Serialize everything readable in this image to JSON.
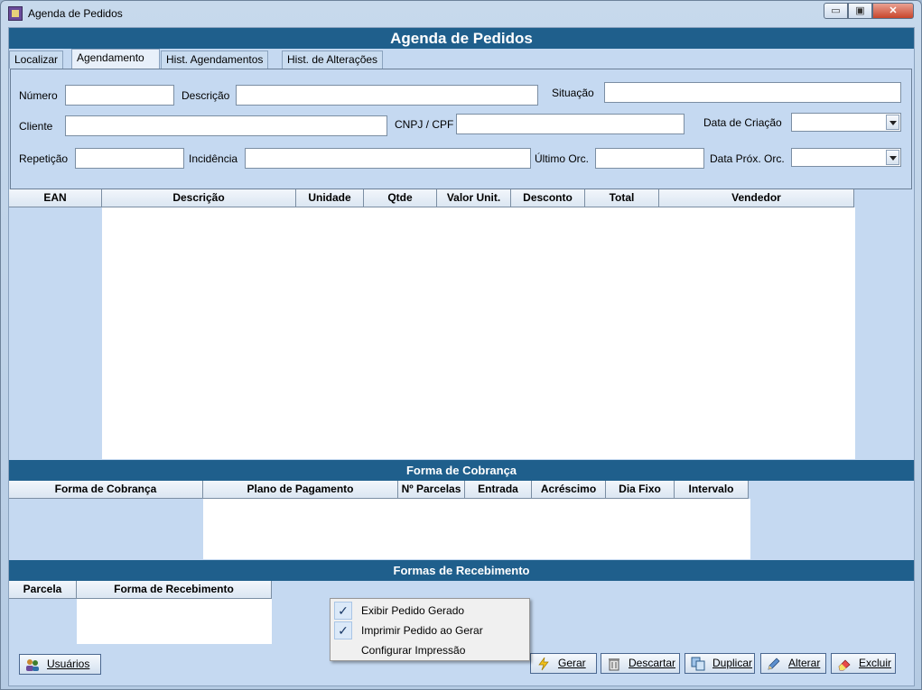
{
  "window": {
    "title": "Agenda de Pedidos",
    "controls": {
      "minimize": "▭",
      "maximize": "▣",
      "close": "✕"
    }
  },
  "banner": "Agenda de Pedidos",
  "tabs": [
    "Localizar",
    "Agendamento",
    "Hist. Agendamentos",
    "Hist. de Alterações"
  ],
  "active_tab": 1,
  "form": {
    "numero_label": "Número",
    "descricao_label": "Descrição",
    "situacao_label": "Situação",
    "cliente_label": "Cliente",
    "cnpj_label": "CNPJ / CPF",
    "data_criacao_label": "Data de Criação",
    "repeticao_label": "Repetição",
    "incidencia_label": "Incidência",
    "ultimo_orc_label": "Último Orc.",
    "data_prox_orc_label": "Data Próx. Orc."
  },
  "items_columns": [
    "EAN",
    "Descrição",
    "Unidade",
    "Qtde",
    "Valor Unit.",
    "Desconto",
    "Total",
    "Vendedor"
  ],
  "cobranca": {
    "title": "Forma de Cobrança",
    "columns": [
      "Forma de Cobrança",
      "Plano de Pagamento",
      "Nº Parcelas",
      "Entrada",
      "Acréscimo",
      "Dia Fixo",
      "Intervalo"
    ]
  },
  "recebimento": {
    "title": "Formas de Recebimento",
    "columns": [
      "Parcela",
      "Forma de Recebimento"
    ]
  },
  "context_menu": {
    "items": [
      {
        "label": "Exibir Pedido Gerado",
        "checked": true,
        "check": "✓"
      },
      {
        "label": "Imprimir Pedido ao Gerar",
        "checked": true,
        "check": "✓"
      },
      {
        "label": "Configurar Impressão",
        "checked": false
      }
    ]
  },
  "buttons": {
    "usuarios": "Usuários",
    "gerar": "Gerar",
    "descartar": "Descartar",
    "duplicar": "Duplicar",
    "alterar": "Alterar",
    "excluir": "Excluir"
  },
  "colors": {
    "header_blue": "#1f5f8c",
    "panel_bg": "#c5d9f1"
  }
}
